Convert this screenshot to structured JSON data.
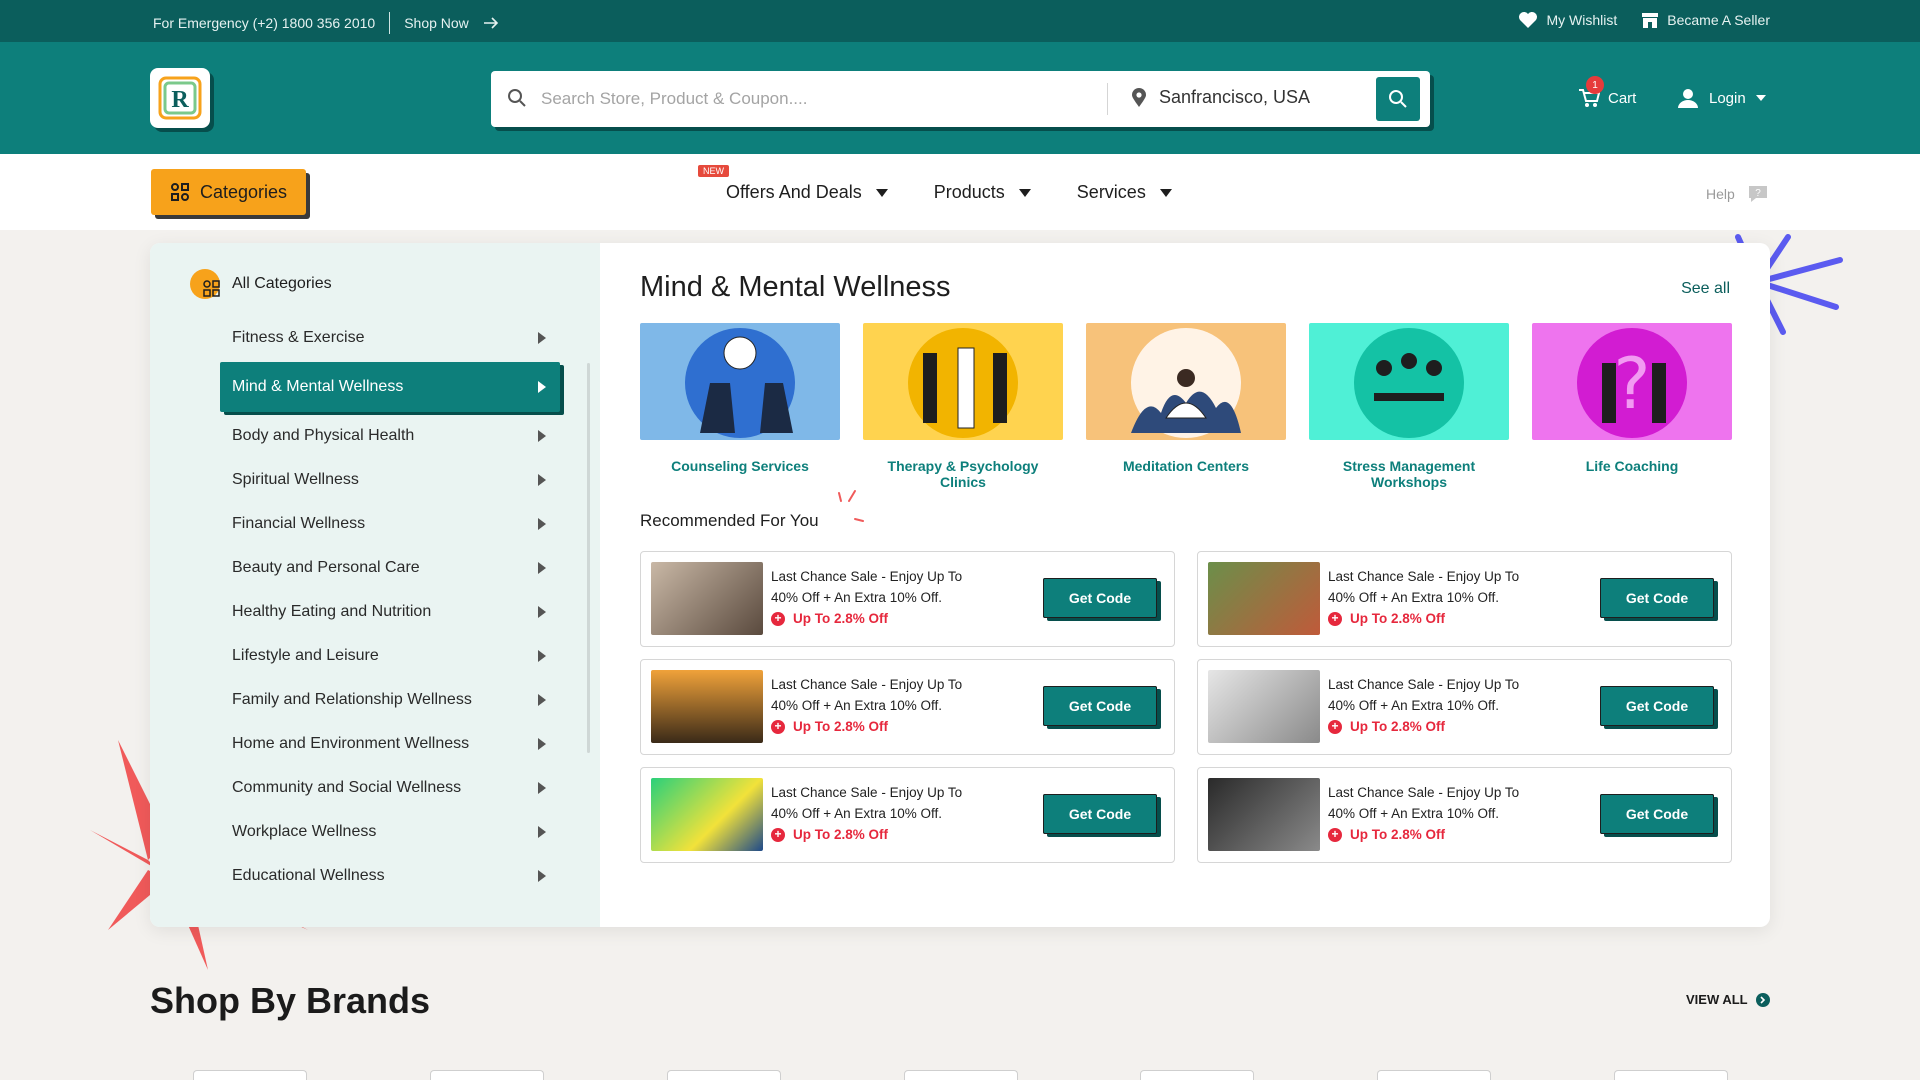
{
  "topbar": {
    "emergency": "For Emergency (+2) 1800 356 2010",
    "shop_now": "Shop Now",
    "wishlist": "My Wishlist",
    "seller": "Became A Seller"
  },
  "header": {
    "logo_letter": "R",
    "search_placeholder": "Search Store, Product & Coupon....",
    "location": "Sanfrancisco, USA",
    "cart_label": "Cart",
    "cart_count": "1",
    "login_label": "Login"
  },
  "nav": {
    "categories_label": "Categories",
    "new_badge": "NEW",
    "links": [
      "Offers And Deals",
      "Products",
      "Services"
    ],
    "help": "Help"
  },
  "sidebar": {
    "all_categories": "All Categories",
    "items": [
      "Fitness & Exercise",
      "Mind & Mental Wellness",
      "Body and Physical Health",
      "Spiritual Wellness",
      "Financial Wellness",
      "Beauty and Personal Care",
      "Healthy Eating and Nutrition",
      "Lifestyle and Leisure",
      "Family and Relationship Wellness",
      "Home and Environment Wellness",
      "Community and Social Wellness",
      "Workplace Wellness",
      "Educational Wellness"
    ],
    "active_index": 1
  },
  "main": {
    "title": "Mind & Mental Wellness",
    "see_all": "See all",
    "cards": [
      {
        "label": "Counseling Services",
        "color": "#7fb8e8"
      },
      {
        "label": "Therapy & Psychology Clinics",
        "color": "#ffd34f"
      },
      {
        "label": "Meditation Centers",
        "color": "#f7c27a"
      },
      {
        "label": "Stress Management Workshops",
        "color": "#4ff0d6"
      },
      {
        "label": "Life Coaching",
        "color": "#ee74ee"
      }
    ],
    "recommended": "Recommended For You",
    "deals": [
      {
        "line1": "Last Chance Sale - Enjoy Up To",
        "line2": "40% Off + An Extra 10% Off.",
        "off": "Up To 2.8% Off",
        "button": "Get Code"
      },
      {
        "line1": "Last Chance Sale - Enjoy Up To",
        "line2": "40% Off + An Extra 10% Off.",
        "off": "Up To 2.8% Off",
        "button": "Get Code"
      },
      {
        "line1": "Last Chance Sale - Enjoy Up To",
        "line2": "40% Off + An Extra 10% Off.",
        "off": "Up To 2.8% Off",
        "button": "Get Code"
      },
      {
        "line1": "Last Chance Sale - Enjoy Up To",
        "line2": "40% Off + An Extra 10% Off.",
        "off": "Up To 2.8% Off",
        "button": "Get Code"
      },
      {
        "line1": "Last Chance Sale - Enjoy Up To",
        "line2": "40% Off + An Extra 10% Off.",
        "off": "Up To 2.8% Off",
        "button": "Get Code"
      },
      {
        "line1": "Last Chance Sale - Enjoy Up To",
        "line2": "40% Off + An Extra 10% Off.",
        "off": "Up To 2.8% Off",
        "button": "Get Code"
      }
    ]
  },
  "brands": {
    "title": "Shop By Brands",
    "view_all": "VIEW ALL"
  },
  "colors": {
    "teal_dark": "#0b5e5c",
    "teal": "#0d7f7b",
    "orange": "#f7a21b",
    "red": "#e6283d"
  }
}
